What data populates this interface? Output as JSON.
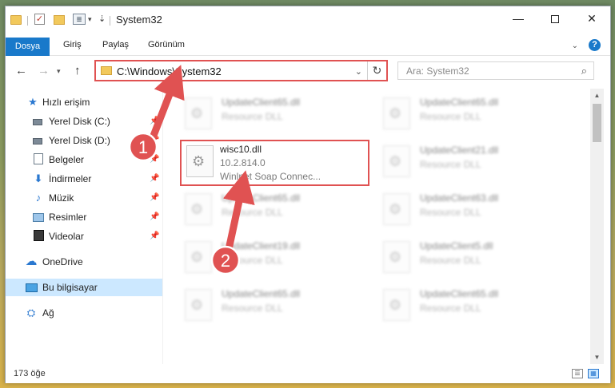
{
  "window": {
    "title": "System32"
  },
  "quick_access_toolbar": {
    "folder_icon": "folder-icon",
    "check_icon": "properties-check-icon",
    "new_folder_icon": "new-folder-icon",
    "customize_icon": "customize-icon"
  },
  "ribbon": {
    "tabs": [
      {
        "label": "Dosya",
        "active": true
      },
      {
        "label": "Giriş"
      },
      {
        "label": "Paylaş"
      },
      {
        "label": "Görünüm"
      }
    ]
  },
  "address_bar": {
    "path": "C:\\Windows\\System32"
  },
  "search": {
    "placeholder": "Ara: System32"
  },
  "sidebar": {
    "items": [
      {
        "label": "Hızlı erişim",
        "icon": "star-icon"
      },
      {
        "label": "Yerel Disk (C:)",
        "icon": "drive-icon",
        "pinned": true
      },
      {
        "label": "Yerel Disk (D:)",
        "icon": "drive-icon",
        "pinned": true
      },
      {
        "label": "Belgeler",
        "icon": "documents-icon",
        "pinned": true
      },
      {
        "label": "İndirmeler",
        "icon": "downloads-icon",
        "pinned": true
      },
      {
        "label": "Müzik",
        "icon": "music-icon",
        "pinned": true
      },
      {
        "label": "Resimler",
        "icon": "pictures-icon",
        "pinned": true
      },
      {
        "label": "Videolar",
        "icon": "videos-icon",
        "pinned": true
      },
      {
        "label": "OneDrive",
        "icon": "onedrive-icon"
      },
      {
        "label": "Bu bilgisayar",
        "icon": "this-pc-icon",
        "selected": true
      },
      {
        "label": "Ağ",
        "icon": "network-icon"
      }
    ]
  },
  "files": {
    "left": [
      {
        "name": "UpdateClient65.dll",
        "type": "Resource DLL"
      },
      {
        "name": "wisc10.dll",
        "version": "10.2.814.0",
        "description": "Winlnet Soap Connec..."
      },
      {
        "name": "UpdateClient65.dll",
        "type": "Resource DLL"
      },
      {
        "name": "UpdateClient19.dll",
        "type": "Resource DLL"
      },
      {
        "name": "UpdateClient65.dll",
        "type": "Resource DLL"
      }
    ],
    "right": [
      {
        "name": "UpdateClient65.dll",
        "type": "Resource DLL"
      },
      {
        "name": "UpdateClient21.dll",
        "type": "Resource DLL"
      },
      {
        "name": "UpdateClient63.dll",
        "type": "Resource DLL"
      },
      {
        "name": "UpdateClient5.dll",
        "type": "Resource DLL"
      },
      {
        "name": "UpdateClient65.dll",
        "type": "Resource DLL"
      }
    ]
  },
  "status_bar": {
    "item_count": "173 öğe"
  },
  "annotations": {
    "step1": "1",
    "step2": "2",
    "color": "#e05252"
  }
}
